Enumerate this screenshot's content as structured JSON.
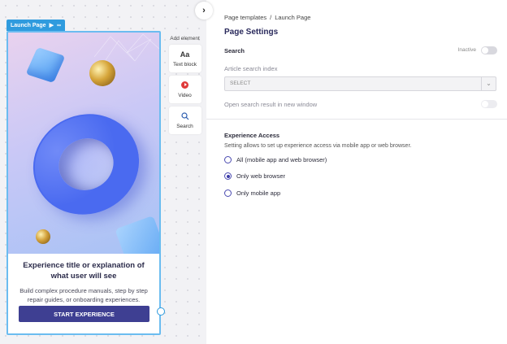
{
  "canvas": {
    "tag": {
      "label": "Launch Page",
      "play_icon": "play-icon",
      "link_icon": "link-icon"
    },
    "card": {
      "title": "Experience title or explanation of what user will see",
      "description": "Build complex procedure manuals, step by step repair guides, or onboarding experiences.",
      "button_label": "START EXPERIENCE"
    },
    "add_element": {
      "title": "Add element",
      "items": [
        {
          "icon": "text-icon",
          "glyph": "Aa",
          "label": "Text block"
        },
        {
          "icon": "video-icon",
          "glyph": "",
          "label": "Video"
        },
        {
          "icon": "search-icon",
          "glyph": "⚲",
          "label": "Search"
        }
      ]
    }
  },
  "settings": {
    "breadcrumb": [
      "Page templates",
      "Launch Page"
    ],
    "breadcrumb_sep": "/",
    "title": "Page Settings",
    "search": {
      "label": "Search",
      "status": "Inactive",
      "index_label": "Article search index",
      "select_placeholder": "SELECT",
      "new_window_label": "Open search result in new window"
    },
    "access": {
      "label": "Experience Access",
      "description": "Setting allows to set up experience access via mobile app or web browser.",
      "options": [
        {
          "label": "All (mobile app and web browser)",
          "checked": false
        },
        {
          "label": "Only web browser",
          "checked": true
        },
        {
          "label": "Only mobile app",
          "checked": false
        }
      ]
    }
  },
  "colors": {
    "accent": "#3e3f92",
    "selection": "#2f9bde",
    "torus": "#4a6af0"
  }
}
